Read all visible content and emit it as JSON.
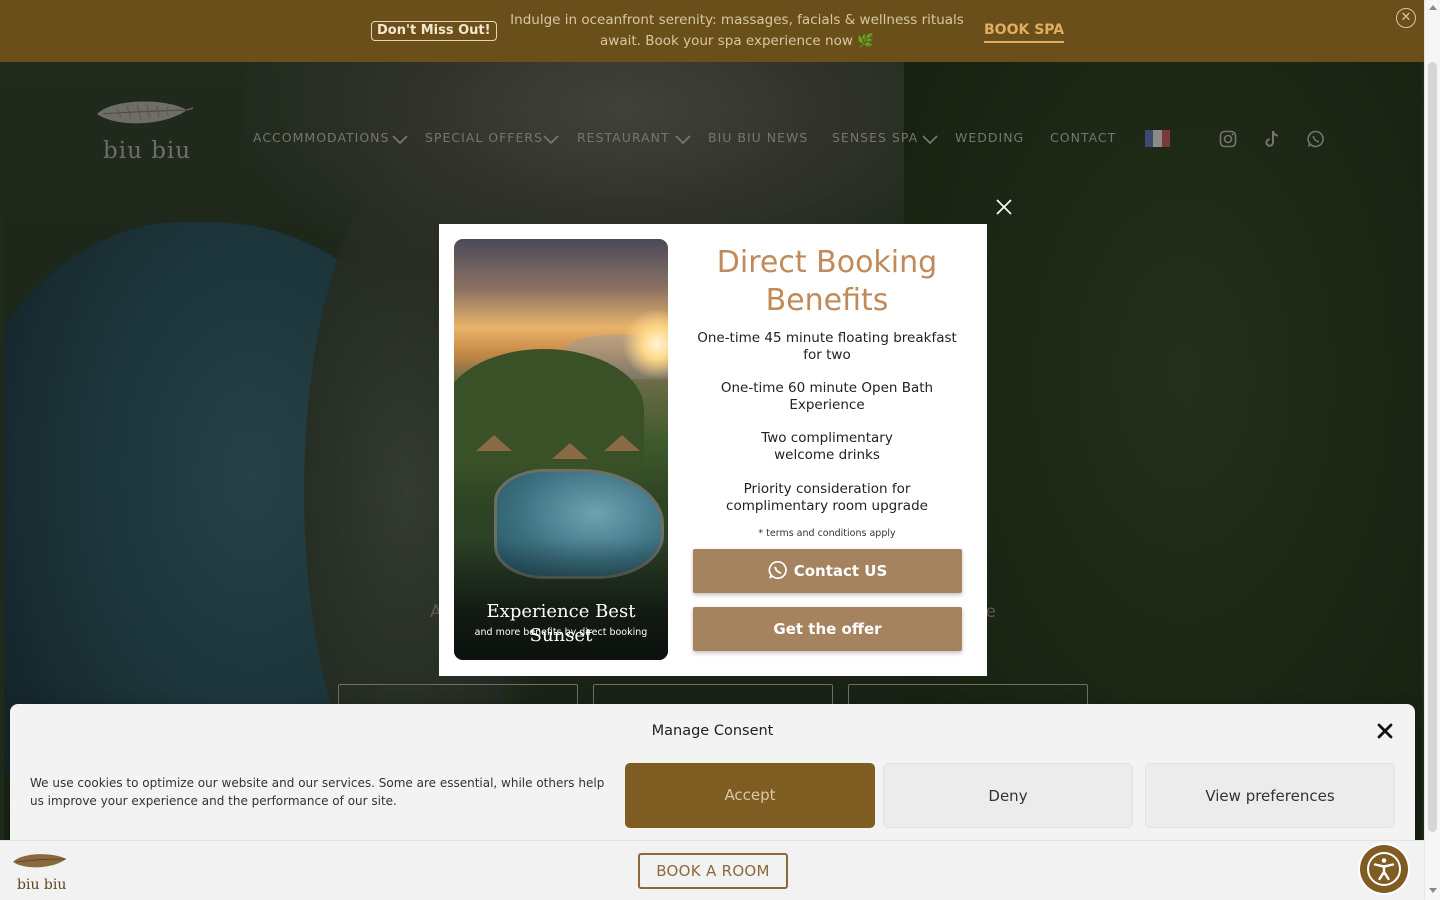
{
  "promo": {
    "badge": "Don't Miss Out!",
    "message": "Indulge in oceanfront serenity: massages, facials & wellness rituals await. Book your spa experience now 🌿",
    "cta": "BOOK SPA",
    "close_icon": "close-circle-icon"
  },
  "header": {
    "logo_text": "biu biu",
    "nav": [
      {
        "label": "ACCOMMODATIONS",
        "dropdown": true
      },
      {
        "label": "SPECIAL OFFERS",
        "dropdown": true
      },
      {
        "label": "RESTAURANT",
        "dropdown": true
      },
      {
        "label": "BIU BIU NEWS",
        "dropdown": false
      },
      {
        "label": "SENSES SPA",
        "dropdown": true
      },
      {
        "label": "WEDDING",
        "dropdown": false
      },
      {
        "label": "CONTACT",
        "dropdown": false
      }
    ],
    "language_flag": "french-flag-icon",
    "social": [
      "instagram-icon",
      "tiktok-icon",
      "whatsapp-icon"
    ]
  },
  "modal": {
    "title": "Direct Booking Benefits",
    "benefits": [
      "One-time 45 minute floating breakfast for two",
      "One-time 60 minute Open Bath Experience",
      "Two complimentary welcome drinks",
      "Priority consideration for complimentary room upgrade"
    ],
    "terms": "* terms and conditions apply",
    "contact_button": "Contact US",
    "offer_button": "Get the offer",
    "image_title": "Experience Best Sunset",
    "image_subtitle": "and more benefits by direct booking"
  },
  "consent": {
    "title": "Manage Consent",
    "message": "We use cookies to optimize our website and our services. Some are essential, while others help us improve your experience and the performance of our site.",
    "accept": "Accept",
    "deny": "Deny",
    "preferences": "View preferences"
  },
  "bottom_bar": {
    "logo_text": "biu biu",
    "book_button": "BOOK A ROOM"
  },
  "colors": {
    "promo_bg": "#6a4f1b",
    "accent_gold": "#e0ae62",
    "modal_title": "#c08a5a",
    "modal_button": "#a5835f",
    "accept_bg": "#7f5d22"
  }
}
